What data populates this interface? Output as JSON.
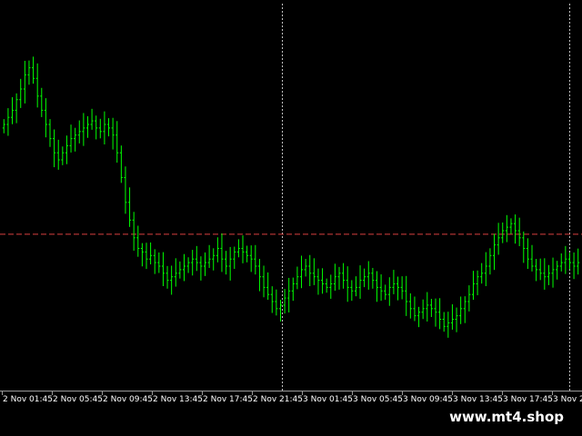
{
  "watermark": "www.mt4.shop",
  "colors": {
    "background": "#000000",
    "candle": "#00ff00",
    "grid": "#c0c0c0",
    "price_level": "#ff4b4b",
    "axis": "#9a9a9a",
    "text": "#ffffff"
  },
  "chart_data": {
    "type": "bar",
    "title": "",
    "xlabel": "",
    "ylabel": "",
    "x_ticks": [
      "2 Nov 01:45",
      "2 Nov 05:45",
      "2 Nov 09:45",
      "2 Nov 13:45",
      "2 Nov 17:45",
      "2 Nov 21:45",
      "3 Nov 01:45",
      "3 Nov 05:45",
      "3 Nov 09:45",
      "3 Nov 13:45",
      "3 Nov 17:45",
      "3 Nov 2"
    ],
    "ylim": [
      0,
      100
    ],
    "price_level": 39,
    "vertical_markers": [
      "2 Nov 21:45",
      "3 Nov 21:45"
    ],
    "grid": false,
    "close_series": [
      70,
      72,
      74,
      77,
      80,
      84,
      86,
      83,
      78,
      74,
      70,
      66,
      62,
      60,
      62,
      64,
      66,
      67,
      68,
      69,
      70,
      71,
      69,
      68,
      70,
      69,
      67,
      62,
      55,
      48,
      43,
      38,
      35,
      34,
      32,
      33,
      31,
      30,
      28,
      26,
      27,
      28,
      29,
      30,
      31,
      32,
      31,
      30,
      31,
      32,
      33,
      35,
      32,
      30,
      32,
      34,
      35,
      34,
      33,
      32,
      30,
      27,
      24,
      22,
      20,
      18,
      19,
      21,
      23,
      25,
      27,
      29,
      30,
      28,
      27,
      26,
      25,
      24,
      25,
      27,
      28,
      26,
      24,
      23,
      24,
      26,
      27,
      28,
      26,
      24,
      23,
      22,
      24,
      25,
      24,
      23,
      20,
      18,
      16,
      17,
      18,
      19,
      18,
      17,
      15,
      13,
      14,
      15,
      16,
      18,
      20,
      22,
      25,
      27,
      28,
      30,
      33,
      36,
      38,
      40,
      41,
      42,
      40,
      38,
      35,
      32,
      30,
      29,
      28,
      27,
      28,
      29,
      30,
      31,
      32,
      31,
      30,
      31
    ]
  }
}
